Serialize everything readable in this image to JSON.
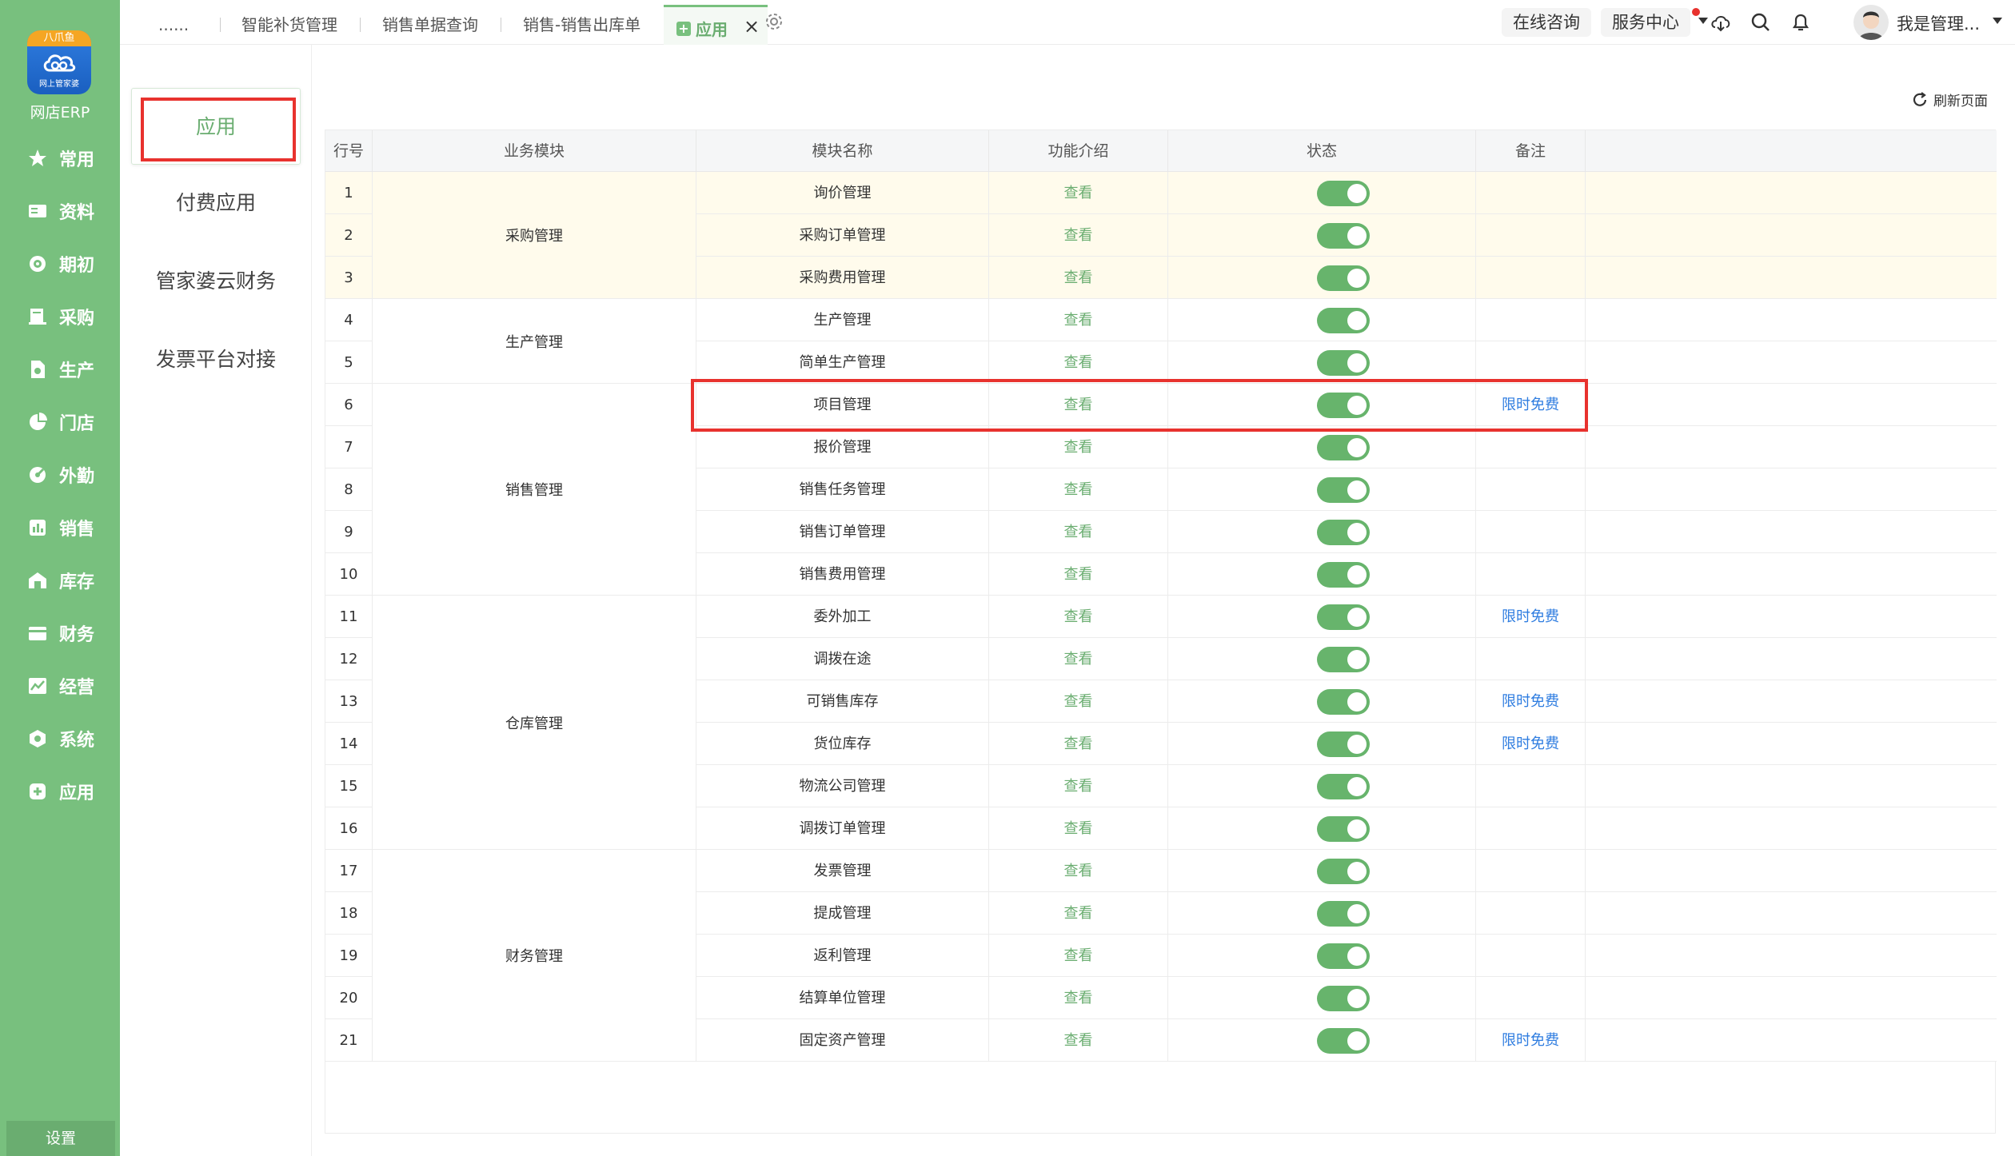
{
  "sidebar": {
    "logo_top": "八爪鱼",
    "logo_sub": "网上管家婆",
    "brand": "网店ERP",
    "items": [
      {
        "label": "常用",
        "icon": "star-icon"
      },
      {
        "label": "资料",
        "icon": "id-card-icon"
      },
      {
        "label": "期初",
        "icon": "target-icon"
      },
      {
        "label": "采购",
        "icon": "book-icon"
      },
      {
        "label": "生产",
        "icon": "document-icon"
      },
      {
        "label": "门店",
        "icon": "pie-chart-icon"
      },
      {
        "label": "外勤",
        "icon": "gauge-icon"
      },
      {
        "label": "销售",
        "icon": "bar-chart-icon"
      },
      {
        "label": "库存",
        "icon": "warehouse-icon"
      },
      {
        "label": "财务",
        "icon": "wallet-icon"
      },
      {
        "label": "经营",
        "icon": "trend-icon"
      },
      {
        "label": "系统",
        "icon": "hexagon-icon"
      },
      {
        "label": "应用",
        "icon": "plus-square-icon"
      }
    ],
    "settings_label": "设置"
  },
  "topbar": {
    "tabs": [
      "......",
      "智能补货管理",
      "销售单据查询",
      "销售-销售出库单"
    ],
    "active_tab": "应用",
    "online_consult": "在线咨询",
    "service_center": "服务中心",
    "user_name": "我是管理..."
  },
  "subnav": {
    "items": [
      "应用",
      "付费应用",
      "管家婆云财务",
      "发票平台对接"
    ]
  },
  "toolbar": {
    "refresh_label": "刷新页面"
  },
  "table": {
    "headers": [
      "行号",
      "业务模块",
      "模块名称",
      "功能介绍",
      "状态",
      "备注"
    ],
    "view_label": "查看",
    "groups": [
      {
        "name": "采购管理",
        "rows": 3
      },
      {
        "name": "生产管理",
        "rows": 2
      },
      {
        "name": "销售管理",
        "rows": 5
      },
      {
        "name": "仓库管理",
        "rows": 6
      },
      {
        "name": "财务管理",
        "rows": 5
      }
    ],
    "rows": [
      {
        "no": "1",
        "name": "询价管理",
        "note": ""
      },
      {
        "no": "2",
        "name": "采购订单管理",
        "note": ""
      },
      {
        "no": "3",
        "name": "采购费用管理",
        "note": ""
      },
      {
        "no": "4",
        "name": "生产管理",
        "note": ""
      },
      {
        "no": "5",
        "name": "简单生产管理",
        "note": ""
      },
      {
        "no": "6",
        "name": "项目管理",
        "note": "限时免费"
      },
      {
        "no": "7",
        "name": "报价管理",
        "note": ""
      },
      {
        "no": "8",
        "name": "销售任务管理",
        "note": ""
      },
      {
        "no": "9",
        "name": "销售订单管理",
        "note": ""
      },
      {
        "no": "10",
        "name": "销售费用管理",
        "note": ""
      },
      {
        "no": "11",
        "name": "委外加工",
        "note": "限时免费"
      },
      {
        "no": "12",
        "name": "调拨在途",
        "note": ""
      },
      {
        "no": "13",
        "name": "可销售库存",
        "note": "限时免费"
      },
      {
        "no": "14",
        "name": "货位库存",
        "note": "限时免费"
      },
      {
        "no": "15",
        "name": "物流公司管理",
        "note": ""
      },
      {
        "no": "16",
        "name": "调拨订单管理",
        "note": ""
      },
      {
        "no": "17",
        "name": "发票管理",
        "note": ""
      },
      {
        "no": "18",
        "name": "提成管理",
        "note": ""
      },
      {
        "no": "19",
        "name": "返利管理",
        "note": ""
      },
      {
        "no": "20",
        "name": "结算单位管理",
        "note": ""
      },
      {
        "no": "21",
        "name": "固定资产管理",
        "note": "限时免费"
      }
    ]
  }
}
